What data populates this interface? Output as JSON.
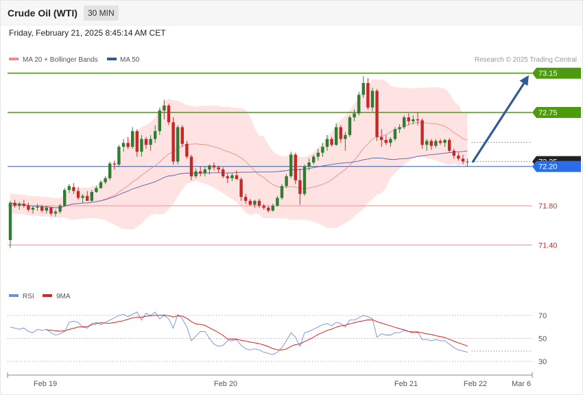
{
  "header": {
    "title": "Crude Oil (WTI)",
    "interval": "30 MIN",
    "datetime": "Friday, February 21, 2025 8:45:14 AM CET"
  },
  "legend": {
    "ma20": "MA 20 + Bollinger Bands",
    "ma50": "MA 50",
    "rsi": "RSI",
    "rsi_ma": "9MA"
  },
  "credit": "Research © 2025 Trading Central",
  "colors": {
    "bull": "#2e7d32",
    "bear": "#c62828",
    "resistance": "#4c9a10",
    "support": "#f2a3a3",
    "band_fill": "#ffdede",
    "ma20": "#f28a8a",
    "ma50": "#5560a8",
    "arrow": "#2f5a9a",
    "current_price": "#2b6de8",
    "rsi": "#6f8ee0",
    "rsi_ma": "#e02020"
  },
  "chart_data": [
    {
      "type": "candlestick",
      "ylim": [
        71.0,
        73.35
      ],
      "xaxis_labels": [
        "Feb 19",
        "Feb 20",
        "Feb 21",
        "Feb 22",
        "Mar 6"
      ],
      "right_labels": {
        "resistance": [
          "73.15",
          "72.75"
        ],
        "support": [
          "71.80",
          "71.40"
        ],
        "last_price": "72.25",
        "current_price": "72.20"
      },
      "levels": {
        "resistance": [
          73.15,
          72.75
        ],
        "support": [
          71.8,
          71.4
        ],
        "last_price": 72.25,
        "current_price": 72.2
      },
      "projection": {
        "from": 72.25,
        "to": 73.15
      },
      "candles_ohlc": [
        [
          71.45,
          71.85,
          71.37,
          71.83
        ],
        [
          71.83,
          71.86,
          71.78,
          71.8
        ],
        [
          71.8,
          71.84,
          71.76,
          71.82
        ],
        [
          71.82,
          71.86,
          71.78,
          71.8
        ],
        [
          71.8,
          71.83,
          71.74,
          71.76
        ],
        [
          71.76,
          71.8,
          71.72,
          71.78
        ],
        [
          71.78,
          71.82,
          71.75,
          71.79
        ],
        [
          71.79,
          71.81,
          71.73,
          71.75
        ],
        [
          71.75,
          71.8,
          71.72,
          71.78
        ],
        [
          71.78,
          71.79,
          71.7,
          71.72
        ],
        [
          71.72,
          71.76,
          71.69,
          71.74
        ],
        [
          71.74,
          71.82,
          71.72,
          71.8
        ],
        [
          71.8,
          71.98,
          71.79,
          71.96
        ],
        [
          71.96,
          72.02,
          71.93,
          72.0
        ],
        [
          71.99,
          72.03,
          71.92,
          71.95
        ],
        [
          71.95,
          71.99,
          71.86,
          71.88
        ],
        [
          71.88,
          71.92,
          71.83,
          71.9
        ],
        [
          71.9,
          71.95,
          71.86,
          71.85
        ],
        [
          71.85,
          71.96,
          71.84,
          71.94
        ],
        [
          71.94,
          72.0,
          71.93,
          71.98
        ],
        [
          71.98,
          72.06,
          71.97,
          72.04
        ],
        [
          72.04,
          72.1,
          72.02,
          72.08
        ],
        [
          72.08,
          72.25,
          72.06,
          72.23
        ],
        [
          72.23,
          72.26,
          72.17,
          72.22
        ],
        [
          72.22,
          72.42,
          72.2,
          72.4
        ],
        [
          72.4,
          72.48,
          72.35,
          72.44
        ],
        [
          72.44,
          72.5,
          72.38,
          72.4
        ],
        [
          72.4,
          72.6,
          72.38,
          72.56
        ],
        [
          72.56,
          72.58,
          72.3,
          72.35
        ],
        [
          72.35,
          72.52,
          72.3,
          72.48
        ],
        [
          72.48,
          72.5,
          72.38,
          72.42
        ],
        [
          72.42,
          72.52,
          72.36,
          72.48
        ],
        [
          72.48,
          72.62,
          72.44,
          72.56
        ],
        [
          72.56,
          72.8,
          72.52,
          72.77
        ],
        [
          72.77,
          72.88,
          72.68,
          72.82
        ],
        [
          72.82,
          72.84,
          72.62,
          72.65
        ],
        [
          72.65,
          72.7,
          72.22,
          72.25
        ],
        [
          72.25,
          72.62,
          72.22,
          72.6
        ],
        [
          72.6,
          72.62,
          72.4,
          72.43
        ],
        [
          72.43,
          72.46,
          72.28,
          72.3
        ],
        [
          72.3,
          72.32,
          72.06,
          72.1
        ],
        [
          72.1,
          72.18,
          72.08,
          72.15
        ],
        [
          72.15,
          72.2,
          72.1,
          72.13
        ],
        [
          72.13,
          72.2,
          72.1,
          72.17
        ],
        [
          72.17,
          72.22,
          72.12,
          72.21
        ],
        [
          72.21,
          72.24,
          72.16,
          72.19
        ],
        [
          72.19,
          72.21,
          72.14,
          72.17
        ],
        [
          72.17,
          72.19,
          72.08,
          72.1
        ],
        [
          72.1,
          72.13,
          72.03,
          72.08
        ],
        [
          72.08,
          72.13,
          72.05,
          72.11
        ],
        [
          72.11,
          72.16,
          72.07,
          72.07
        ],
        [
          72.07,
          72.09,
          71.85,
          71.89
        ],
        [
          71.89,
          71.92,
          71.82,
          71.85
        ],
        [
          71.85,
          71.87,
          71.8,
          71.81
        ],
        [
          71.81,
          71.86,
          71.78,
          71.85
        ],
        [
          71.85,
          71.87,
          71.78,
          71.8
        ],
        [
          71.8,
          71.82,
          71.76,
          71.78
        ],
        [
          71.78,
          71.8,
          71.73,
          71.75
        ],
        [
          71.75,
          71.82,
          71.74,
          71.8
        ],
        [
          71.8,
          71.9,
          71.79,
          71.88
        ],
        [
          71.88,
          72.02,
          71.86,
          72.0
        ],
        [
          72.0,
          72.12,
          71.98,
          72.1
        ],
        [
          72.1,
          72.35,
          72.08,
          72.32
        ],
        [
          72.32,
          72.34,
          72.02,
          72.06
        ],
        [
          72.06,
          72.18,
          71.81,
          71.92
        ],
        [
          71.92,
          72.22,
          71.9,
          72.2
        ],
        [
          72.2,
          72.28,
          72.16,
          72.24
        ],
        [
          72.24,
          72.32,
          72.22,
          72.3
        ],
        [
          72.3,
          72.38,
          72.26,
          72.34
        ],
        [
          72.34,
          72.44,
          72.3,
          72.4
        ],
        [
          72.4,
          72.52,
          72.36,
          72.48
        ],
        [
          72.48,
          72.5,
          72.4,
          72.42
        ],
        [
          72.42,
          72.64,
          72.41,
          72.6
        ],
        [
          72.6,
          72.62,
          72.44,
          72.48
        ],
        [
          72.48,
          72.55,
          72.36,
          72.52
        ],
        [
          72.52,
          72.72,
          72.5,
          72.7
        ],
        [
          72.7,
          72.78,
          72.66,
          72.74
        ],
        [
          72.74,
          72.96,
          72.72,
          72.93
        ],
        [
          72.93,
          73.12,
          72.9,
          73.05
        ],
        [
          73.05,
          73.1,
          72.78,
          72.8
        ],
        [
          72.8,
          73.0,
          72.76,
          72.97
        ],
        [
          72.97,
          72.99,
          72.46,
          72.5
        ],
        [
          72.5,
          72.58,
          72.4,
          72.47
        ],
        [
          72.47,
          72.52,
          72.42,
          72.44
        ],
        [
          72.44,
          72.5,
          72.4,
          72.48
        ],
        [
          72.48,
          72.6,
          72.46,
          72.58
        ],
        [
          72.58,
          72.63,
          72.54,
          72.6
        ],
        [
          72.6,
          72.72,
          72.58,
          72.7
        ],
        [
          72.7,
          72.74,
          72.62,
          72.66
        ],
        [
          72.66,
          72.72,
          72.63,
          72.68
        ],
        [
          72.68,
          72.75,
          72.62,
          72.67
        ],
        [
          72.67,
          72.69,
          72.38,
          72.42
        ],
        [
          72.42,
          72.48,
          72.36,
          72.46
        ],
        [
          72.46,
          72.48,
          72.37,
          72.41
        ],
        [
          72.41,
          72.48,
          72.39,
          72.46
        ],
        [
          72.46,
          72.48,
          72.42,
          72.44
        ],
        [
          72.44,
          72.48,
          72.4,
          72.47
        ],
        [
          72.47,
          72.49,
          72.34,
          72.36
        ],
        [
          72.36,
          72.38,
          72.28,
          72.31
        ],
        [
          72.31,
          72.34,
          72.26,
          72.28
        ],
        [
          72.28,
          72.32,
          72.22,
          72.25
        ],
        [
          72.25,
          72.28,
          72.2,
          72.25
        ]
      ]
    },
    {
      "type": "line",
      "title": "RSI",
      "ylim": [
        22,
        82
      ],
      "ticks": [
        70,
        50,
        30
      ],
      "tick_labels": [
        "70",
        "50",
        "30"
      ],
      "series": [
        {
          "name": "RSI",
          "values": [
            60,
            59,
            58,
            59,
            56,
            55,
            58,
            57,
            58,
            55,
            53,
            54,
            56,
            64,
            65,
            64,
            60,
            59,
            63,
            64,
            62,
            64,
            66,
            68,
            70,
            71,
            69,
            71,
            73,
            66,
            72,
            70,
            73,
            67,
            70,
            67,
            59,
            71,
            67,
            60,
            48,
            52,
            56,
            56,
            50,
            45,
            43,
            44,
            48,
            48,
            49,
            44,
            41,
            40,
            41,
            40,
            38,
            37,
            36,
            38,
            42,
            48,
            55,
            51,
            43,
            55,
            56,
            58,
            60,
            62,
            63,
            61,
            64,
            63,
            60,
            66,
            66,
            68,
            70,
            69,
            67,
            51,
            54,
            53,
            53,
            55,
            55,
            57,
            56,
            56,
            56,
            49,
            49,
            48,
            49,
            48,
            48,
            45,
            42,
            40,
            39,
            38
          ]
        },
        {
          "name": "9MA",
          "values": [
            null,
            null,
            null,
            null,
            null,
            null,
            null,
            null,
            57.3,
            57.2,
            56.6,
            56.3,
            56.6,
            57.8,
            58.9,
            59.9,
            60.1,
            60.3,
            61.8,
            62.9,
            63.7,
            63.4,
            63.2,
            63.8,
            64.7,
            65.4,
            66.7,
            67.9,
            68.4,
            68.5,
            69.3,
            69.9,
            70.1,
            70.1,
            70.3,
            69.9,
            68.6,
            69.7,
            69.4,
            67.5,
            64.7,
            62.6,
            62.2,
            61.4,
            59.2,
            57.3,
            55.1,
            52.6,
            49.4,
            49.6,
            49.4,
            48.4,
            47.8,
            46.8,
            46.2,
            45.4,
            44.3,
            42.9,
            41.1,
            40.2,
            40.0,
            40.8,
            43.2,
            44.6,
            45.2,
            47.4,
            49.0,
            51.2,
            53.5,
            55.2,
            57.0,
            58.1,
            59.8,
            61.0,
            61.6,
            62.7,
            63.7,
            64.7,
            65.3,
            66.2,
            66.3,
            64.6,
            63.4,
            62.1,
            60.9,
            59.7,
            58.4,
            57.5,
            56.0,
            55.0,
            55.4,
            54.9,
            54.0,
            53.4,
            52.4,
            51.7,
            50.8,
            49.2,
            47.6,
            46.1,
            44.8,
            43.4
          ]
        }
      ]
    }
  ]
}
